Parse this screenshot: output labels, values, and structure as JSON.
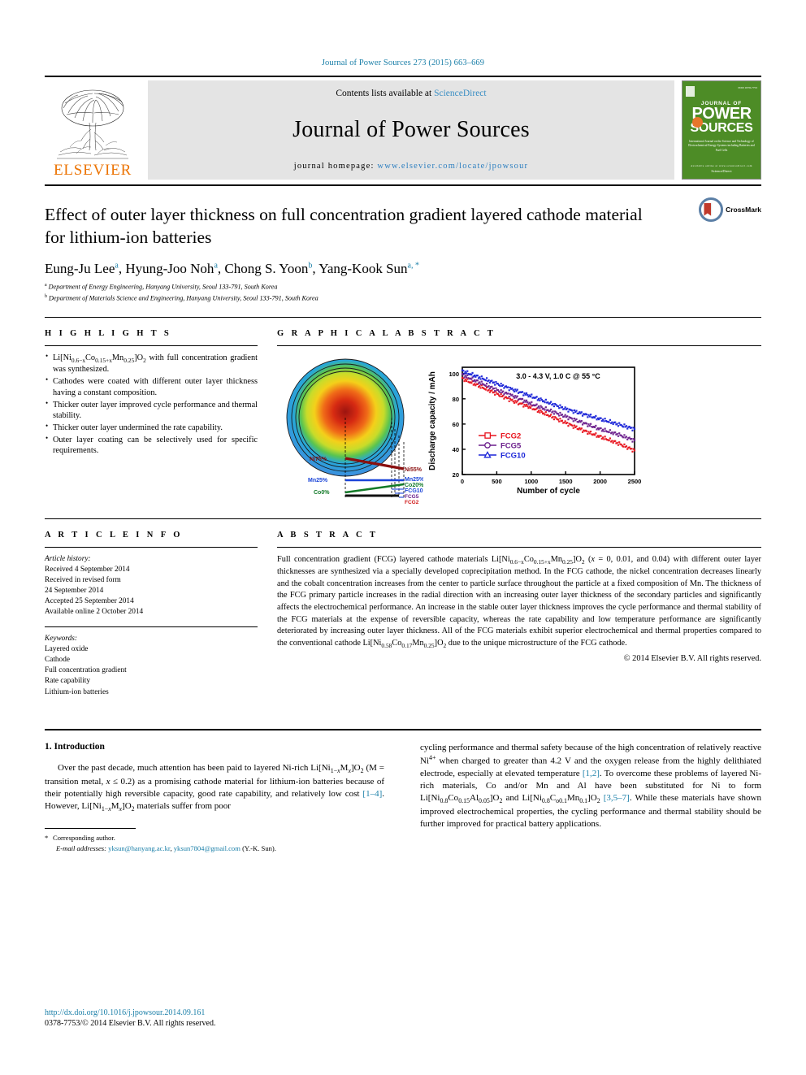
{
  "running_head": "Journal of Power Sources 273 (2015) 663–669",
  "masthead": {
    "contents_prefix": "Contents lists available at ",
    "sciencedirect": "ScienceDirect",
    "journal_name": "Journal of Power Sources",
    "homepage_prefix": "journal homepage: ",
    "homepage_url": "www.elsevier.com/locate/jpowsour",
    "publisher": "ELSEVIER",
    "cover": {
      "journal_of": "JOURNAL OF",
      "power": "POWER",
      "sources": "SOURCES",
      "subtitle": "International Journal on the Science and Technology of Electrochemical Energy Systems including Batteries and Fuel Cells",
      "issn": "ISSN 0378-7753",
      "footer1": "Available online at www.sciencedirect.com",
      "footer2": "ScienceDirect"
    }
  },
  "title": "Effect of outer layer thickness on full concentration gradient layered cathode material for lithium-ion batteries",
  "crossmark": {
    "label": "CrossMark"
  },
  "authors": [
    {
      "name": "Eung-Ju Lee",
      "marks": "a"
    },
    {
      "name": "Hyung-Joo Noh",
      "marks": "a"
    },
    {
      "name": "Chong S. Yoon",
      "marks": "b"
    },
    {
      "name": "Yang-Kook Sun",
      "marks": "a, *"
    }
  ],
  "affiliations": [
    {
      "mark": "a",
      "text": "Department of Energy Engineering, Hanyang University, Seoul 133-791, South Korea"
    },
    {
      "mark": "b",
      "text": "Department of Materials Science and Engineering, Hanyang University, Seoul 133-791, South Korea"
    }
  ],
  "highlights": {
    "heading": "H I G H L I G H T S",
    "items": [
      "Li[Ni0.6−xCo0.15+xMn0.25]O2 with full concentration gradient was synthesized.",
      "Cathodes were coated with different outer layer thickness having a constant composition.",
      "Thicker outer layer improved cycle performance and thermal stability.",
      "Thicker outer layer undermined the rate capability.",
      "Outer layer coating can be selectively used for specific requirements."
    ]
  },
  "graphical_abstract": {
    "heading": "G R A P H I C A L   A B S T R A C T",
    "particle_labels": {
      "ni_center": "Ni75%",
      "ni_surface": "Ni55%",
      "mn_center": "Mn25%",
      "mn_surface": "Mn25%",
      "co_center": "Co0%",
      "co_surface": "Co20%",
      "fcg10": "FCG10",
      "fcg5": "FCG5",
      "fcg2": "FCG2"
    }
  },
  "chart_data": {
    "type": "line",
    "title": "",
    "annotation": "3.0 - 4.3 V, 1.0 C @ 55 °C",
    "xlabel": "Number of cycle",
    "ylabel": "Discharge capacity / mAh",
    "xlim": [
      0,
      2500
    ],
    "ylim": [
      20,
      105
    ],
    "xticks": [
      0,
      500,
      1000,
      1500,
      2000,
      2500
    ],
    "yticks": [
      20,
      40,
      60,
      80,
      100
    ],
    "grid": false,
    "legend_position": "lower-left",
    "series": [
      {
        "name": "FCG2",
        "color": "#e8141e",
        "marker": "square",
        "x": [
          0,
          250,
          500,
          750,
          1000,
          1250,
          1500,
          1750,
          2000,
          2250,
          2500
        ],
        "y": [
          96,
          90,
          84,
          78,
          73,
          67,
          61,
          55,
          50,
          45,
          39
        ]
      },
      {
        "name": "FCG5",
        "color": "#6b1f8c",
        "marker": "circle",
        "x": [
          0,
          250,
          500,
          750,
          1000,
          1250,
          1500,
          1750,
          2000,
          2250,
          2500
        ],
        "y": [
          99,
          93,
          87,
          82,
          76,
          71,
          66,
          61,
          56,
          52,
          47
        ]
      },
      {
        "name": "FCG10",
        "color": "#1a24d8",
        "marker": "triangle",
        "x": [
          0,
          250,
          500,
          750,
          1000,
          1250,
          1500,
          1750,
          2000,
          2250,
          2500
        ],
        "y": [
          102,
          97,
          92,
          87,
          82,
          77,
          72,
          68,
          64,
          60,
          56
        ]
      }
    ]
  },
  "article_info": {
    "heading": "A R T I C L E   I N F O",
    "history_label": "Article history:",
    "history": [
      "Received 4 September 2014",
      "Received in revised form",
      "24 September 2014",
      "Accepted 25 September 2014",
      "Available online 2 October 2014"
    ],
    "keywords_label": "Keywords:",
    "keywords": [
      "Layered oxide",
      "Cathode",
      "Full concentration gradient",
      "Rate capability",
      "Lithium-ion batteries"
    ]
  },
  "abstract": {
    "heading": "A B S T R A C T",
    "paragraph_1": "Full concentration gradient (FCG) layered cathode materials Li[Ni0.6−xCo0.15+xMn0.25]O2 (x = 0, 0.01, and 0.04) with different outer layer thicknesses are synthesized via a specially developed coprecipitation method. In the FCG cathode, the nickel concentration decreases linearly and the cobalt concentration increases from the center to particle surface throughout the particle at a fixed composition of Mn. The thickness of the FCG primary particle increases in the radial direction with an increasing outer layer thickness of the secondary particles and significantly affects the electrochemical performance. An increase in the stable outer layer thickness improves the cycle performance and thermal stability of the FCG materials at the expense of reversible capacity, whereas the rate capability and low temperature performance are significantly deteriorated by increasing outer layer thickness. All of the FCG materials exhibit superior electrochemical and thermal properties compared to the conventional cathode Li[Ni0.58Co0.17Mn0.25]O2 due to the unique microstructure of the FCG cathode.",
    "copyright": "© 2014 Elsevier B.V. All rights reserved."
  },
  "introduction": {
    "number_heading": "1.  Introduction",
    "left_paragraph": "Over the past decade, much attention has been paid to layered Ni-rich Li[Ni1−xMx]O2 (M = transition metal, x ≤ 0.2) as a promising cathode material for lithium-ion batteries because of their potentially high reversible capacity, good rate capability, and relatively low cost [1–4]. However, Li[Ni1−xMx]O2 materials suffer from poor",
    "right_paragraph": "cycling performance and thermal safety because of the high concentration of relatively reactive Ni4+ when charged to greater than 4.2 V and the oxygen release from the highly delithiated electrode, especially at elevated temperature [1,2]. To overcome these problems of layered Ni-rich materials, Co and/or Mn and Al have been substituted for Ni to form Li[Ni0.8Co0.15Al0.05]O2 and Li[Ni0.8Co0.1Mn0.1]O2 [3,5–7]. While these materials have shown improved electrochemical properties, the cycling performance and thermal stability should be further improved for practical battery applications."
  },
  "footnote": {
    "star": "*",
    "corresponding": "Corresponding author.",
    "email_label": "E-mail addresses:",
    "email_1": "yksun@hanyang.ac.kr",
    "email_2": "yksun7804@gmail.com",
    "email_suffix": "(Y.-K. Sun)."
  },
  "footer": {
    "doi": "http://dx.doi.org/10.1016/j.jpowsour.2014.09.161",
    "issn_line": "0378-7753/© 2014 Elsevier B.V. All rights reserved."
  }
}
